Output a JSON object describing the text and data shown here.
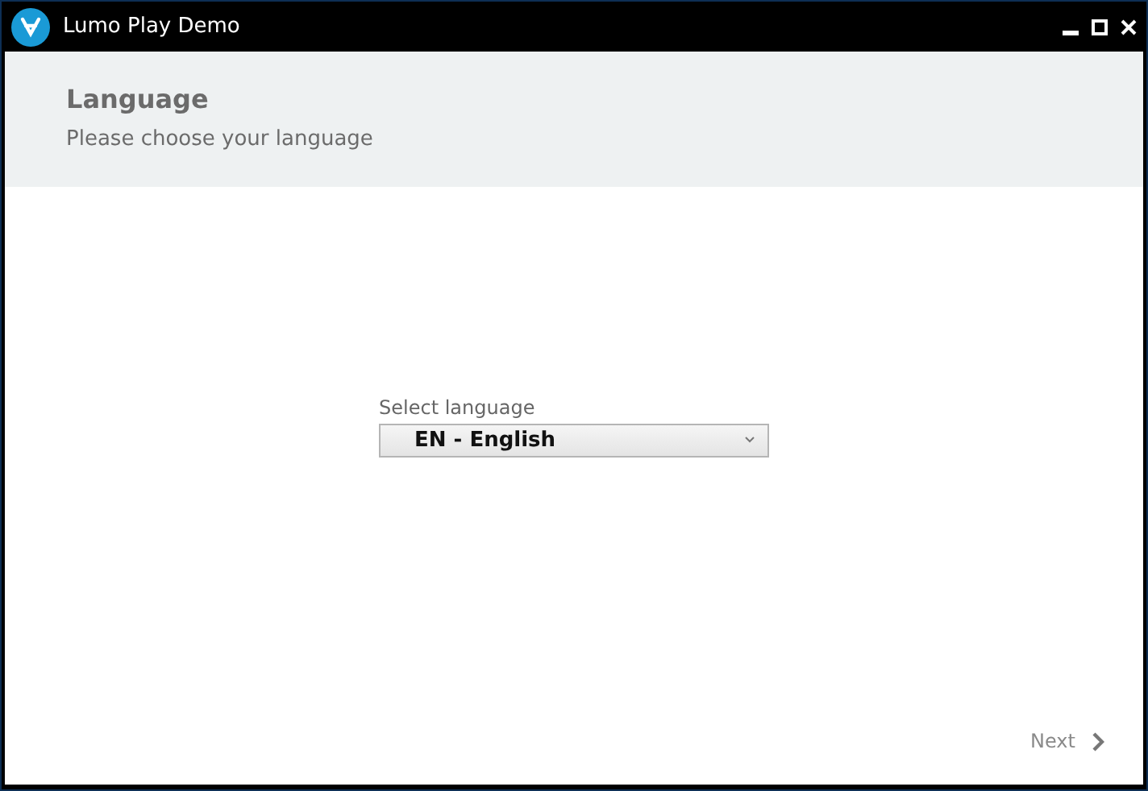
{
  "window": {
    "title": "Lumo Play Demo"
  },
  "header": {
    "title": "Language",
    "subtitle": "Please choose your language"
  },
  "language_select": {
    "label": "Select language",
    "value": "EN - English"
  },
  "footer": {
    "next_button": "Next"
  }
}
